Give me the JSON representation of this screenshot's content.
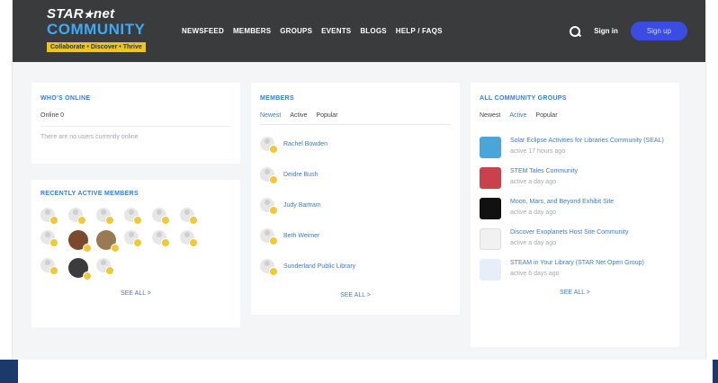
{
  "brand": {
    "line1": "STAR",
    "line1_b": "net",
    "line2": "COMMUNITY",
    "tagline": "Collaborate • Discover • Thrive"
  },
  "nav": [
    "NEWSFEED",
    "MEMBERS",
    "GROUPS",
    "EVENTS",
    "BLOGS",
    "HELP / FAQS"
  ],
  "header": {
    "signin": "Sign in",
    "signup": "Sign up"
  },
  "whos_online": {
    "title": "WHO'S ONLINE",
    "count": "Online 0",
    "empty": "There are no users currently online"
  },
  "recent": {
    "title": "RECENTLY ACTIVE MEMBERS",
    "see_all": "SEE ALL >"
  },
  "members": {
    "title": "MEMBERS",
    "tabs": [
      "Newest",
      "Active",
      "Popular"
    ],
    "items": [
      "Rachel Bowden",
      "Deidre Bush",
      "Judy Bartram",
      "Beth Weimer",
      "Sunderland Public Library"
    ],
    "see_all": "SEE ALL >"
  },
  "groups": {
    "title": "ALL COMMUNITY GROUPS",
    "tabs": [
      "Newest",
      "Active",
      "Popular"
    ],
    "items": [
      {
        "name": "Solar Eclipse Activities for Libraries Community (SEAL)",
        "time": "active 17 hours ago"
      },
      {
        "name": "STEM Tales Community",
        "time": "active a day ago"
      },
      {
        "name": "Moon, Mars, and Beyond Exhibit Site",
        "time": "active a day ago"
      },
      {
        "name": "Discover Exoplanets Host Site Community",
        "time": "active a day ago"
      },
      {
        "name": "STEAM in Your Library (STAR Net Open Group)",
        "time": "active 6 days ago"
      }
    ],
    "see_all": "SEE ALL >"
  },
  "colors": {
    "accent": "#3a7bd5",
    "topbar": "#3a3b3d",
    "signup": "#3b4ce2",
    "badge": "#f0c93a"
  }
}
